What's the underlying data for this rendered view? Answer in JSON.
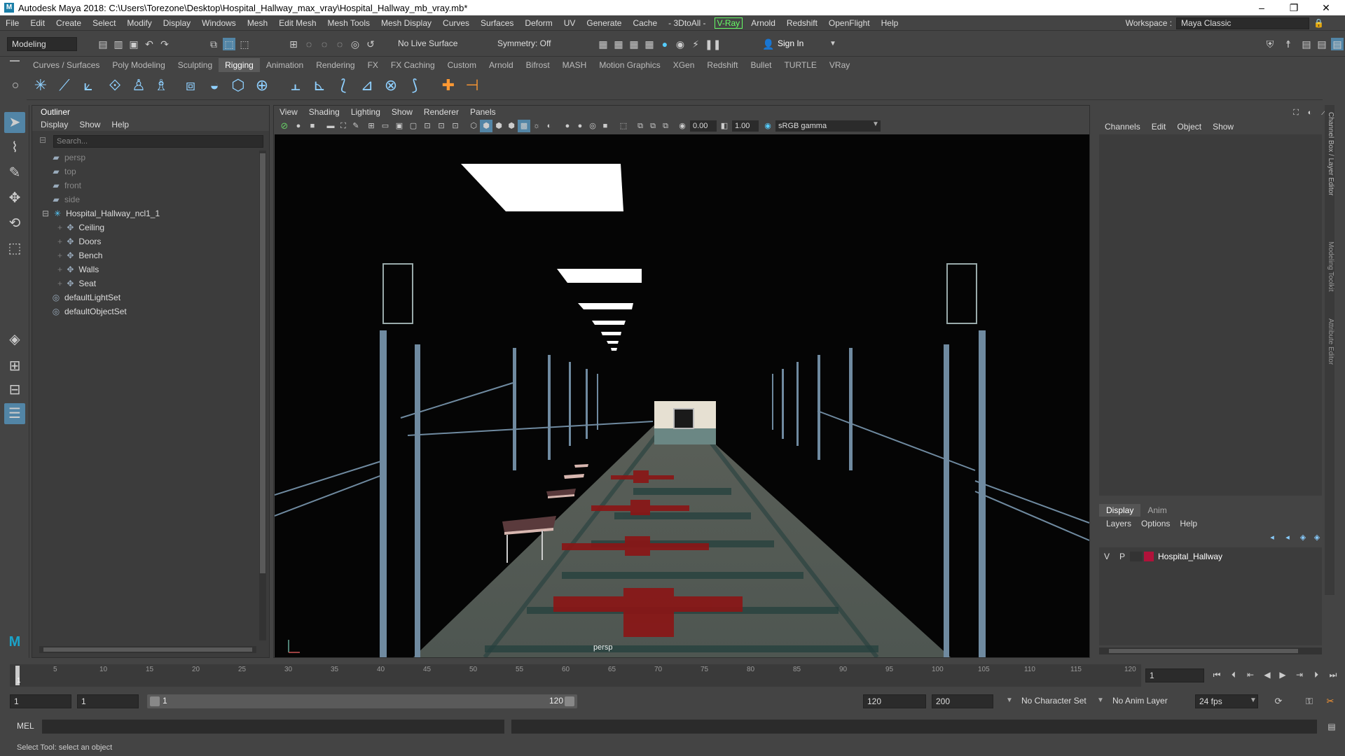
{
  "app": {
    "title": "Autodesk Maya 2018: C:\\Users\\Torezone\\Desktop\\Hospital_Hallway_max_vray\\Hospital_Hallway_mb_vray.mb*",
    "window_controls": [
      "–",
      "❐",
      "✕"
    ]
  },
  "menubar": {
    "items": [
      "File",
      "Edit",
      "Create",
      "Select",
      "Modify",
      "Display",
      "Windows",
      "Mesh",
      "Edit Mesh",
      "Mesh Tools",
      "Mesh Display",
      "Curves",
      "Surfaces",
      "Deform",
      "UV",
      "Generate",
      "Cache",
      "- 3DtoAll -",
      "V-Ray",
      "Arnold",
      "Redshift",
      "OpenFlight",
      "Help"
    ],
    "workspace_label": "Workspace :",
    "workspace_value": "Maya Classic"
  },
  "statusline": {
    "mode": "Modeling",
    "live_surface": "No Live Surface",
    "symmetry": "Symmetry: Off",
    "sign_in": "Sign In"
  },
  "shelf": {
    "tabs": [
      "Curves / Surfaces",
      "Poly Modeling",
      "Sculpting",
      "Rigging",
      "Animation",
      "Rendering",
      "FX",
      "FX Caching",
      "Custom",
      "Arnold",
      "Bifrost",
      "MASH",
      "Motion Graphics",
      "XGen",
      "Redshift",
      "Bullet",
      "TURTLE",
      "VRay"
    ],
    "active_tab": "Rigging"
  },
  "outliner": {
    "title": "Outliner",
    "menu": [
      "Display",
      "Show",
      "Help"
    ],
    "search_placeholder": "Search...",
    "cameras": [
      "persp",
      "top",
      "front",
      "side"
    ],
    "group": "Hospital_Hallway_ncl1_1",
    "children": [
      "Ceiling",
      "Doors",
      "Bench",
      "Walls",
      "Seat"
    ],
    "sets": [
      "defaultLightSet",
      "defaultObjectSet"
    ]
  },
  "viewport": {
    "menu": [
      "View",
      "Shading",
      "Lighting",
      "Show",
      "Renderer",
      "Panels"
    ],
    "exposure": "0.00",
    "gamma": "1.00",
    "color_space": "sRGB gamma",
    "camera_label": "persp"
  },
  "channel_box": {
    "menu": [
      "Channels",
      "Edit",
      "Object",
      "Show"
    ],
    "side_tabs": [
      "Channel Box / Layer Editor",
      "Modeling Toolkit",
      "Attribute Editor"
    ]
  },
  "layer_editor": {
    "tabs": [
      "Display",
      "Anim"
    ],
    "menu": [
      "Layers",
      "Options",
      "Help"
    ],
    "layer": {
      "v": "V",
      "p": "P",
      "name": "Hospital_Hallway",
      "color": "#b0123a"
    }
  },
  "timeline": {
    "ticks": [
      "1",
      "5",
      "10",
      "15",
      "20",
      "25",
      "30",
      "35",
      "40",
      "45",
      "50",
      "55",
      "60",
      "65",
      "70",
      "75",
      "80",
      "85",
      "90",
      "95",
      "100",
      "105",
      "110",
      "115",
      "120"
    ],
    "current_frame": "1"
  },
  "range": {
    "start": "1",
    "playback_start": "1",
    "slider_start": "1",
    "slider_end": "120",
    "playback_end": "120",
    "end": "200",
    "character_set": "No Character Set",
    "anim_layer": "No Anim Layer",
    "fps": "24 fps"
  },
  "command": {
    "label": "MEL"
  },
  "help": {
    "text": "Select Tool: select an object"
  }
}
